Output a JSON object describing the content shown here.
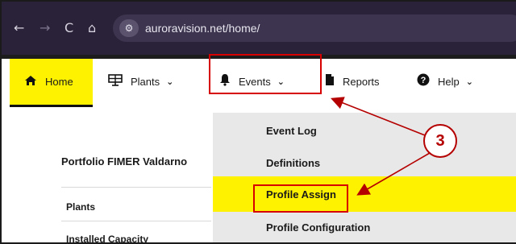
{
  "browser": {
    "back_icon": "arrow-left-icon",
    "forward_icon": "arrow-right-icon",
    "reload_icon": "reload-icon",
    "home_icon": "home-icon",
    "site_info_icon": "site-settings-icon",
    "url": "auroravision.net/home/"
  },
  "nav": {
    "home": {
      "label": "Home",
      "icon": "home-icon"
    },
    "plants": {
      "label": "Plants",
      "icon": "solar-panel-icon"
    },
    "events": {
      "label": "Events",
      "icon": "bell-icon"
    },
    "reports": {
      "label": "Reports",
      "icon": "document-icon"
    },
    "help": {
      "label": "Help",
      "icon": "question-circle-icon"
    }
  },
  "page": {
    "portfolio_title": "Portfolio FIMER Valdarno",
    "rows": [
      {
        "label": "Plants"
      },
      {
        "label": "Installed Capacity"
      }
    ]
  },
  "dropdown": {
    "items": [
      {
        "label": "Event Log"
      },
      {
        "label": "Definitions"
      },
      {
        "label": "Profile Assign"
      },
      {
        "label": "Profile Configuration"
      }
    ],
    "active_index": 2
  },
  "annotation": {
    "step_number": "3"
  },
  "colors": {
    "browser_bg": "#2a2238",
    "accent_yellow": "#fff200",
    "annotation_red": "#d60000",
    "dropdown_bg": "#e8e8e8"
  }
}
